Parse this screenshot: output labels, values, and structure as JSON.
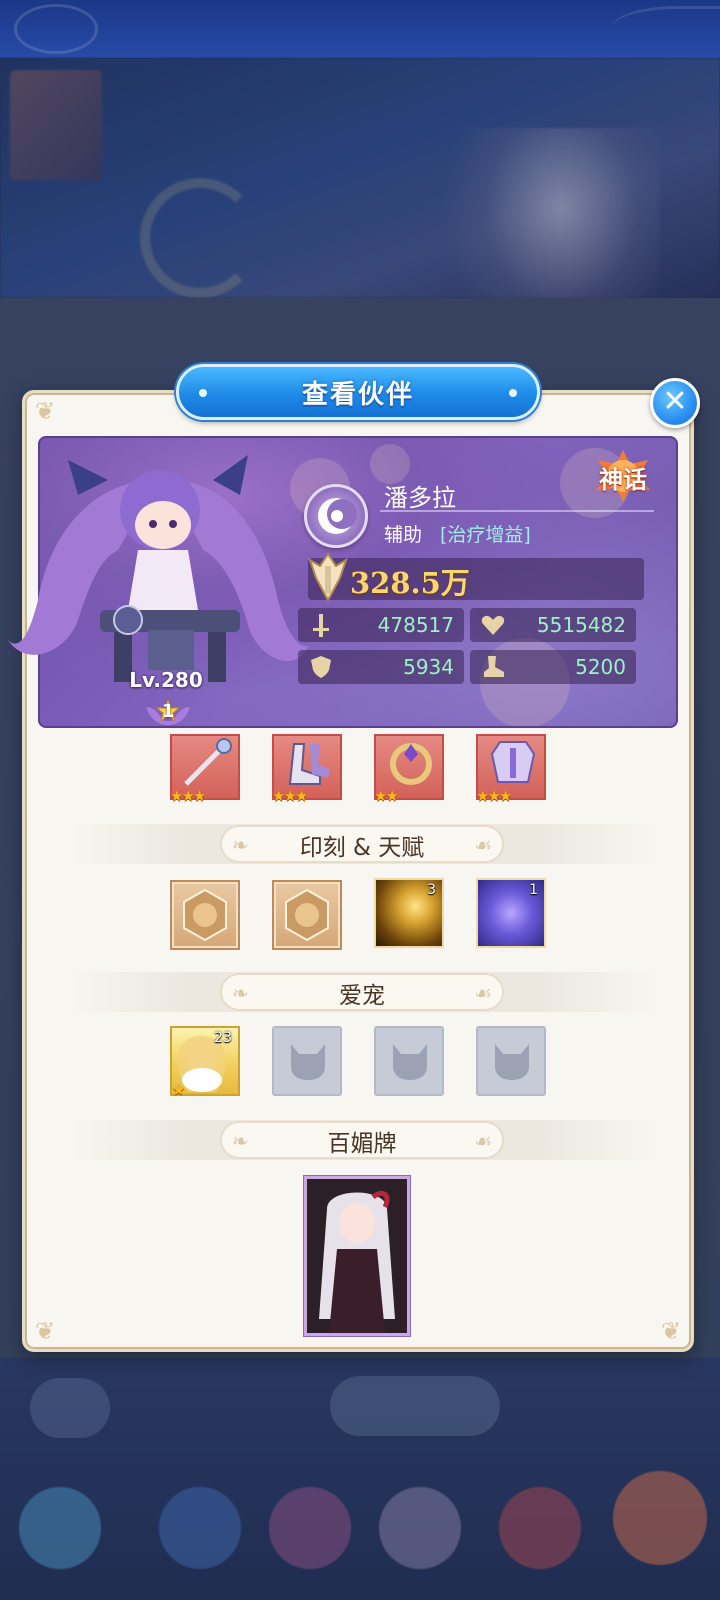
{
  "modal": {
    "title": "查看伙伴",
    "close_icon": "close-icon"
  },
  "hero": {
    "name": "潘多拉",
    "role": "辅助",
    "role_tag": "[治疗增益]",
    "rarity": "神话",
    "level": "Lv.280",
    "star_rank": "1",
    "power": "328.5万",
    "stats": {
      "attack": "478517",
      "hp": "5515482",
      "defense": "5934",
      "speed": "5200"
    }
  },
  "equipment": [
    {
      "icon": "staff-icon",
      "stars": "★★★"
    },
    {
      "icon": "boots-icon",
      "stars": "★★★"
    },
    {
      "icon": "ring-icon",
      "stars": "★★"
    },
    {
      "icon": "armor-icon",
      "stars": "★★★"
    }
  ],
  "sections": {
    "runes_talents": "印刻 & 天赋",
    "pets": "爱宠",
    "charm_cards": "百媚牌"
  },
  "talents": [
    {
      "type": "rune",
      "icon": "emblem-icon"
    },
    {
      "type": "rune",
      "icon": "emblem-icon"
    },
    {
      "type": "talent",
      "icon": "gold-slash-icon",
      "count": "3"
    },
    {
      "type": "talent",
      "icon": "blue-swirl-icon",
      "count": "1"
    }
  ],
  "pets": [
    {
      "state": "filled",
      "level": "23",
      "stars": "★"
    },
    {
      "state": "empty",
      "icon": "cat-silhouette-icon"
    },
    {
      "state": "empty",
      "icon": "cat-silhouette-icon"
    },
    {
      "state": "empty",
      "icon": "cat-silhouette-icon"
    }
  ],
  "colors": {
    "title_bar": "#1e8ae8",
    "panel_bg": "#f8f6f1",
    "power_text": "#ffd66b",
    "stat_text": "#9ef0c8",
    "role_tag": "#9ef0e7",
    "equip_bg": "#d3625a"
  }
}
